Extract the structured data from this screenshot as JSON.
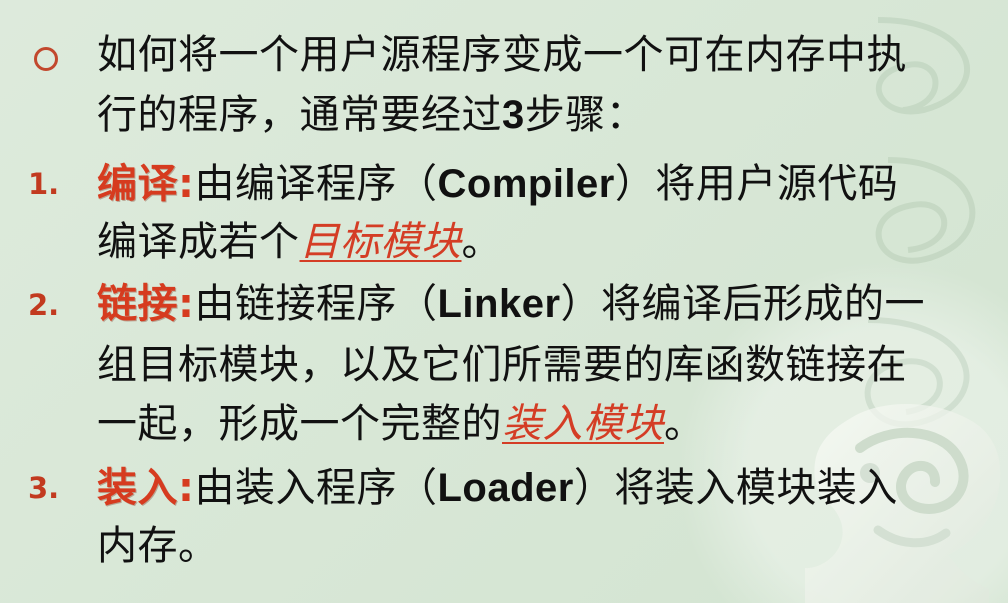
{
  "slide": {
    "intro_line_1": "如何将一个用户源程序变成一个可在内存中执",
    "intro_line_2_prefix": "行的程序，通常要经过",
    "intro_line_2_number": "3",
    "intro_line_2_suffix": "步骤：",
    "items": [
      {
        "number": "1.",
        "term": "编译",
        "colon": ":",
        "line_1_prefix": "由编译程序（",
        "line_1_latin": "Compiler",
        "line_1_suffix": "）将用户源代码",
        "line_2_prefix": "编译成若个",
        "line_2_highlight": "目标模块",
        "line_2_suffix": "。"
      },
      {
        "number": "2.",
        "term": "链接",
        "colon": ":",
        "line_1_prefix": "由链接程序（",
        "line_1_latin": "Linker",
        "line_1_suffix": "）将编译后形成的一",
        "line_2": "组目标模块，以及它们所需要的库函数链接在",
        "line_3_prefix": "一起，形成一个完整的",
        "line_3_highlight": "装入模块",
        "line_3_suffix": "。"
      },
      {
        "number": "3.",
        "term": "装入",
        "colon": ":",
        "line_1_prefix": "由装入程序（",
        "line_1_latin": "Loader",
        "line_1_suffix": "）将装入模块装入",
        "line_2": "内存。"
      }
    ]
  },
  "colors": {
    "background": "#d6e6d4",
    "accent": "#d63b1f",
    "number": "#c23a1f",
    "text": "#111111"
  },
  "icons": {
    "bullet": "circle-bullet-icon",
    "watermark": "dragon-watermark-icon"
  }
}
